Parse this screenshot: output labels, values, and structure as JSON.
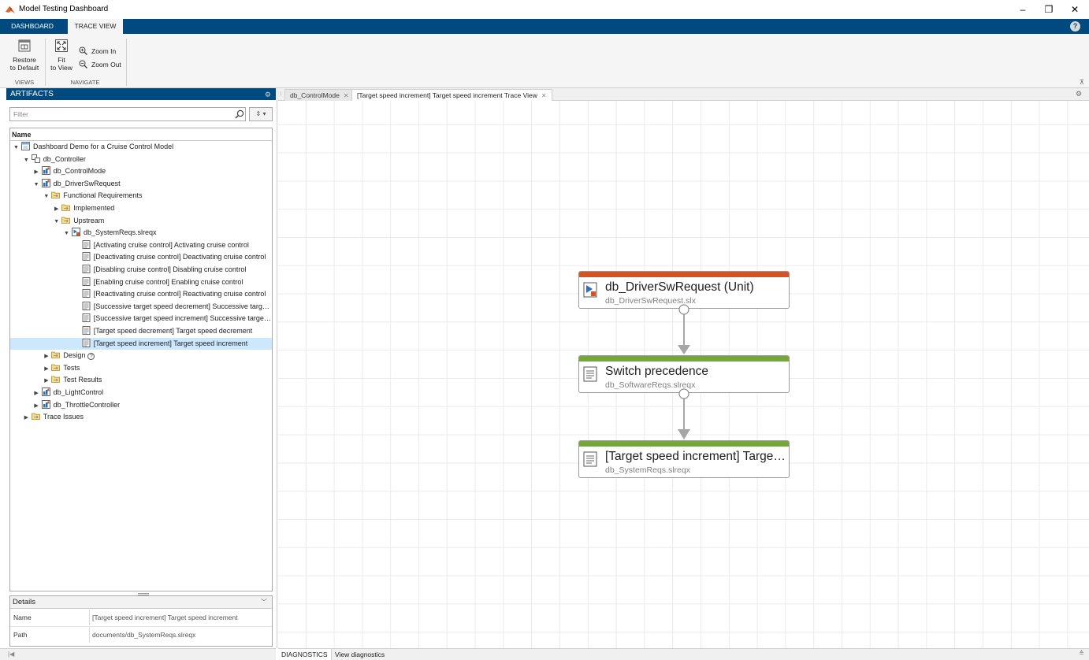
{
  "window": {
    "title": "Model Testing Dashboard",
    "min": "–",
    "max": "❐",
    "close": "✕"
  },
  "ribbon": {
    "tabs": [
      "DASHBOARD",
      "TRACE VIEW"
    ],
    "active_tab": "TRACE VIEW",
    "help": "?",
    "buttons": {
      "restore_line1": "Restore",
      "restore_line2": "to Default",
      "fit_line1": "Fit",
      "fit_line2": "to View",
      "zoom_in": "Zoom In",
      "zoom_out": "Zoom Out"
    },
    "groups": {
      "views": "VIEWS",
      "navigate": "NAVIGATE"
    },
    "collapse": "⊼"
  },
  "artifacts": {
    "title": "ARTIFACTS",
    "filter_placeholder": "Filter",
    "column_header": "Name",
    "tree": [
      {
        "label": "Dashboard Demo for a Cruise Control Model",
        "level": 0,
        "toggle": "▼",
        "icon": "project-icon"
      },
      {
        "label": "db_Controller",
        "level": 1,
        "toggle": "▼",
        "icon": "model-icon"
      },
      {
        "label": "db_ControlMode",
        "level": 2,
        "toggle": "▶",
        "icon": "unit-icon"
      },
      {
        "label": "db_DriverSwRequest",
        "level": 2,
        "toggle": "▼",
        "icon": "unit-icon"
      },
      {
        "label": "Functional Requirements",
        "level": 3,
        "toggle": "▼",
        "icon": "folder-icon"
      },
      {
        "label": "Implemented",
        "level": 4,
        "toggle": "▶",
        "icon": "folder-icon"
      },
      {
        "label": "Upstream",
        "level": 4,
        "toggle": "▼",
        "icon": "folder-icon"
      },
      {
        "label": "db_SystemReqs.slreqx",
        "level": 5,
        "toggle": "▼",
        "icon": "reqset-icon"
      },
      {
        "label": "[Activating cruise control] Activating cruise control",
        "level": 6,
        "toggle": "",
        "icon": "requirement-icon"
      },
      {
        "label": "[Deactivating cruise control] Deactivating cruise control",
        "level": 6,
        "toggle": "",
        "icon": "requirement-icon"
      },
      {
        "label": "[Disabling cruise control] Disabling cruise control",
        "level": 6,
        "toggle": "",
        "icon": "requirement-icon"
      },
      {
        "label": "[Enabling cruise control] Enabling cruise control",
        "level": 6,
        "toggle": "",
        "icon": "requirement-icon"
      },
      {
        "label": "[Reactivating cruise control] Reactivating cruise control",
        "level": 6,
        "toggle": "",
        "icon": "requirement-icon"
      },
      {
        "label": "[Successive target speed decrement] Successive target speed decrement",
        "level": 6,
        "toggle": "",
        "icon": "requirement-icon"
      },
      {
        "label": "[Successive target speed increment] Successive target speed increment",
        "level": 6,
        "toggle": "",
        "icon": "requirement-icon"
      },
      {
        "label": "[Target speed decrement] Target speed decrement",
        "level": 6,
        "toggle": "",
        "icon": "requirement-icon"
      },
      {
        "label": "[Target speed increment] Target speed increment",
        "level": 6,
        "toggle": "",
        "icon": "requirement-icon",
        "selected": true
      },
      {
        "label": "Design",
        "level": 3,
        "toggle": "▶",
        "icon": "folder-icon",
        "badge": "?"
      },
      {
        "label": "Tests",
        "level": 3,
        "toggle": "▶",
        "icon": "folder-icon"
      },
      {
        "label": "Test Results",
        "level": 3,
        "toggle": "▶",
        "icon": "folder-icon"
      },
      {
        "label": "db_LightControl",
        "level": 2,
        "toggle": "▶",
        "icon": "unit-icon"
      },
      {
        "label": "db_ThrottleController",
        "level": 2,
        "toggle": "▶",
        "icon": "unit-icon"
      },
      {
        "label": "Trace Issues",
        "level": 1,
        "toggle": "▶",
        "icon": "folder-icon"
      }
    ]
  },
  "details": {
    "title": "Details",
    "name_label": "Name",
    "name_value": "[Target speed increment] Target speed increment",
    "path_label": "Path",
    "path_value": "documents/db_SystemReqs.slreqx"
  },
  "doc_tabs": [
    {
      "label": "db_ControlMode"
    },
    {
      "label": "[Target speed increment] Target speed increment Trace View"
    }
  ],
  "trace": {
    "nodes": [
      {
        "title": "db_DriverSwRequest (Unit)",
        "subtitle": "db_DriverSwRequest.slx",
        "color": "#d45326",
        "icon": "unit-icon"
      },
      {
        "title": "Switch precedence",
        "subtitle": "db_SoftwareReqs.slreqx",
        "color": "#76a53a",
        "icon": "requirement-icon"
      },
      {
        "title": "[Target speed increment] Target speed increment",
        "subtitle": "db_SystemReqs.slreqx",
        "color": "#76a53a",
        "icon": "requirement-icon"
      }
    ]
  },
  "status": {
    "diagnostics_tab": "DIAGNOSTICS",
    "diagnostics_link": "View diagnostics"
  },
  "colors": {
    "ribbon_blue": "#014a7f",
    "selection": "#cce8ff",
    "unit_orange": "#d45326",
    "req_green": "#76a53a"
  }
}
